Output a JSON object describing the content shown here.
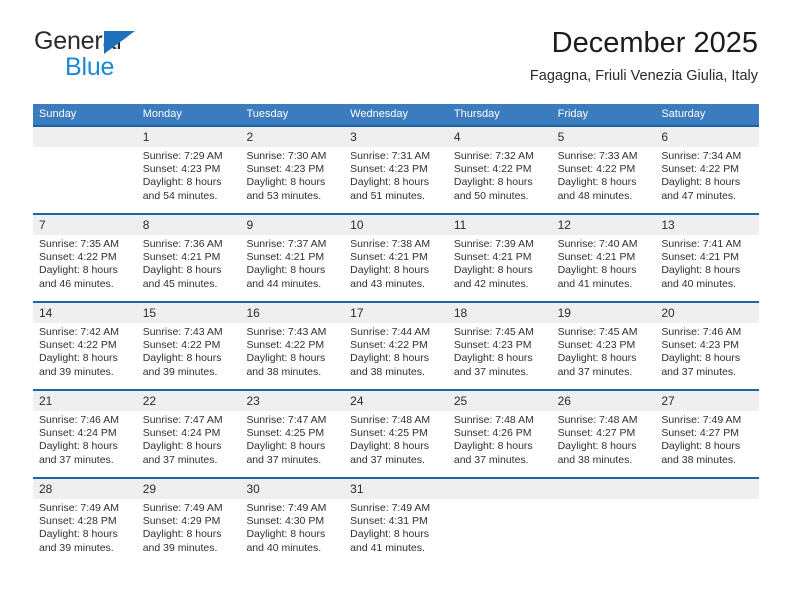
{
  "brand": {
    "name_top": "General",
    "name_bottom": "Blue",
    "triangle_icon": "blue-triangle-icon",
    "color_dark": "#2b2b2b",
    "color_blue": "#1e88d8"
  },
  "header": {
    "title": "December 2025",
    "subtitle": "Fagagna, Friuli Venezia Giulia, Italy"
  },
  "colors": {
    "header_bar": "#3b7cbf",
    "row_divider": "#1c64a8",
    "day_band": "#efefef",
    "text": "#303030"
  },
  "weekdays": [
    "Sunday",
    "Monday",
    "Tuesday",
    "Wednesday",
    "Thursday",
    "Friday",
    "Saturday"
  ],
  "weeks": [
    [
      {
        "day": "",
        "sunrise": "",
        "sunset": "",
        "daylight": ""
      },
      {
        "day": "1",
        "sunrise": "Sunrise: 7:29 AM",
        "sunset": "Sunset: 4:23 PM",
        "daylight": "Daylight: 8 hours and 54 minutes."
      },
      {
        "day": "2",
        "sunrise": "Sunrise: 7:30 AM",
        "sunset": "Sunset: 4:23 PM",
        "daylight": "Daylight: 8 hours and 53 minutes."
      },
      {
        "day": "3",
        "sunrise": "Sunrise: 7:31 AM",
        "sunset": "Sunset: 4:23 PM",
        "daylight": "Daylight: 8 hours and 51 minutes."
      },
      {
        "day": "4",
        "sunrise": "Sunrise: 7:32 AM",
        "sunset": "Sunset: 4:22 PM",
        "daylight": "Daylight: 8 hours and 50 minutes."
      },
      {
        "day": "5",
        "sunrise": "Sunrise: 7:33 AM",
        "sunset": "Sunset: 4:22 PM",
        "daylight": "Daylight: 8 hours and 48 minutes."
      },
      {
        "day": "6",
        "sunrise": "Sunrise: 7:34 AM",
        "sunset": "Sunset: 4:22 PM",
        "daylight": "Daylight: 8 hours and 47 minutes."
      }
    ],
    [
      {
        "day": "7",
        "sunrise": "Sunrise: 7:35 AM",
        "sunset": "Sunset: 4:22 PM",
        "daylight": "Daylight: 8 hours and 46 minutes."
      },
      {
        "day": "8",
        "sunrise": "Sunrise: 7:36 AM",
        "sunset": "Sunset: 4:21 PM",
        "daylight": "Daylight: 8 hours and 45 minutes."
      },
      {
        "day": "9",
        "sunrise": "Sunrise: 7:37 AM",
        "sunset": "Sunset: 4:21 PM",
        "daylight": "Daylight: 8 hours and 44 minutes."
      },
      {
        "day": "10",
        "sunrise": "Sunrise: 7:38 AM",
        "sunset": "Sunset: 4:21 PM",
        "daylight": "Daylight: 8 hours and 43 minutes."
      },
      {
        "day": "11",
        "sunrise": "Sunrise: 7:39 AM",
        "sunset": "Sunset: 4:21 PM",
        "daylight": "Daylight: 8 hours and 42 minutes."
      },
      {
        "day": "12",
        "sunrise": "Sunrise: 7:40 AM",
        "sunset": "Sunset: 4:21 PM",
        "daylight": "Daylight: 8 hours and 41 minutes."
      },
      {
        "day": "13",
        "sunrise": "Sunrise: 7:41 AM",
        "sunset": "Sunset: 4:21 PM",
        "daylight": "Daylight: 8 hours and 40 minutes."
      }
    ],
    [
      {
        "day": "14",
        "sunrise": "Sunrise: 7:42 AM",
        "sunset": "Sunset: 4:22 PM",
        "daylight": "Daylight: 8 hours and 39 minutes."
      },
      {
        "day": "15",
        "sunrise": "Sunrise: 7:43 AM",
        "sunset": "Sunset: 4:22 PM",
        "daylight": "Daylight: 8 hours and 39 minutes."
      },
      {
        "day": "16",
        "sunrise": "Sunrise: 7:43 AM",
        "sunset": "Sunset: 4:22 PM",
        "daylight": "Daylight: 8 hours and 38 minutes."
      },
      {
        "day": "17",
        "sunrise": "Sunrise: 7:44 AM",
        "sunset": "Sunset: 4:22 PM",
        "daylight": "Daylight: 8 hours and 38 minutes."
      },
      {
        "day": "18",
        "sunrise": "Sunrise: 7:45 AM",
        "sunset": "Sunset: 4:23 PM",
        "daylight": "Daylight: 8 hours and 37 minutes."
      },
      {
        "day": "19",
        "sunrise": "Sunrise: 7:45 AM",
        "sunset": "Sunset: 4:23 PM",
        "daylight": "Daylight: 8 hours and 37 minutes."
      },
      {
        "day": "20",
        "sunrise": "Sunrise: 7:46 AM",
        "sunset": "Sunset: 4:23 PM",
        "daylight": "Daylight: 8 hours and 37 minutes."
      }
    ],
    [
      {
        "day": "21",
        "sunrise": "Sunrise: 7:46 AM",
        "sunset": "Sunset: 4:24 PM",
        "daylight": "Daylight: 8 hours and 37 minutes."
      },
      {
        "day": "22",
        "sunrise": "Sunrise: 7:47 AM",
        "sunset": "Sunset: 4:24 PM",
        "daylight": "Daylight: 8 hours and 37 minutes."
      },
      {
        "day": "23",
        "sunrise": "Sunrise: 7:47 AM",
        "sunset": "Sunset: 4:25 PM",
        "daylight": "Daylight: 8 hours and 37 minutes."
      },
      {
        "day": "24",
        "sunrise": "Sunrise: 7:48 AM",
        "sunset": "Sunset: 4:25 PM",
        "daylight": "Daylight: 8 hours and 37 minutes."
      },
      {
        "day": "25",
        "sunrise": "Sunrise: 7:48 AM",
        "sunset": "Sunset: 4:26 PM",
        "daylight": "Daylight: 8 hours and 37 minutes."
      },
      {
        "day": "26",
        "sunrise": "Sunrise: 7:48 AM",
        "sunset": "Sunset: 4:27 PM",
        "daylight": "Daylight: 8 hours and 38 minutes."
      },
      {
        "day": "27",
        "sunrise": "Sunrise: 7:49 AM",
        "sunset": "Sunset: 4:27 PM",
        "daylight": "Daylight: 8 hours and 38 minutes."
      }
    ],
    [
      {
        "day": "28",
        "sunrise": "Sunrise: 7:49 AM",
        "sunset": "Sunset: 4:28 PM",
        "daylight": "Daylight: 8 hours and 39 minutes."
      },
      {
        "day": "29",
        "sunrise": "Sunrise: 7:49 AM",
        "sunset": "Sunset: 4:29 PM",
        "daylight": "Daylight: 8 hours and 39 minutes."
      },
      {
        "day": "30",
        "sunrise": "Sunrise: 7:49 AM",
        "sunset": "Sunset: 4:30 PM",
        "daylight": "Daylight: 8 hours and 40 minutes."
      },
      {
        "day": "31",
        "sunrise": "Sunrise: 7:49 AM",
        "sunset": "Sunset: 4:31 PM",
        "daylight": "Daylight: 8 hours and 41 minutes."
      },
      {
        "day": "",
        "sunrise": "",
        "sunset": "",
        "daylight": ""
      },
      {
        "day": "",
        "sunrise": "",
        "sunset": "",
        "daylight": ""
      },
      {
        "day": "",
        "sunrise": "",
        "sunset": "",
        "daylight": ""
      }
    ]
  ]
}
